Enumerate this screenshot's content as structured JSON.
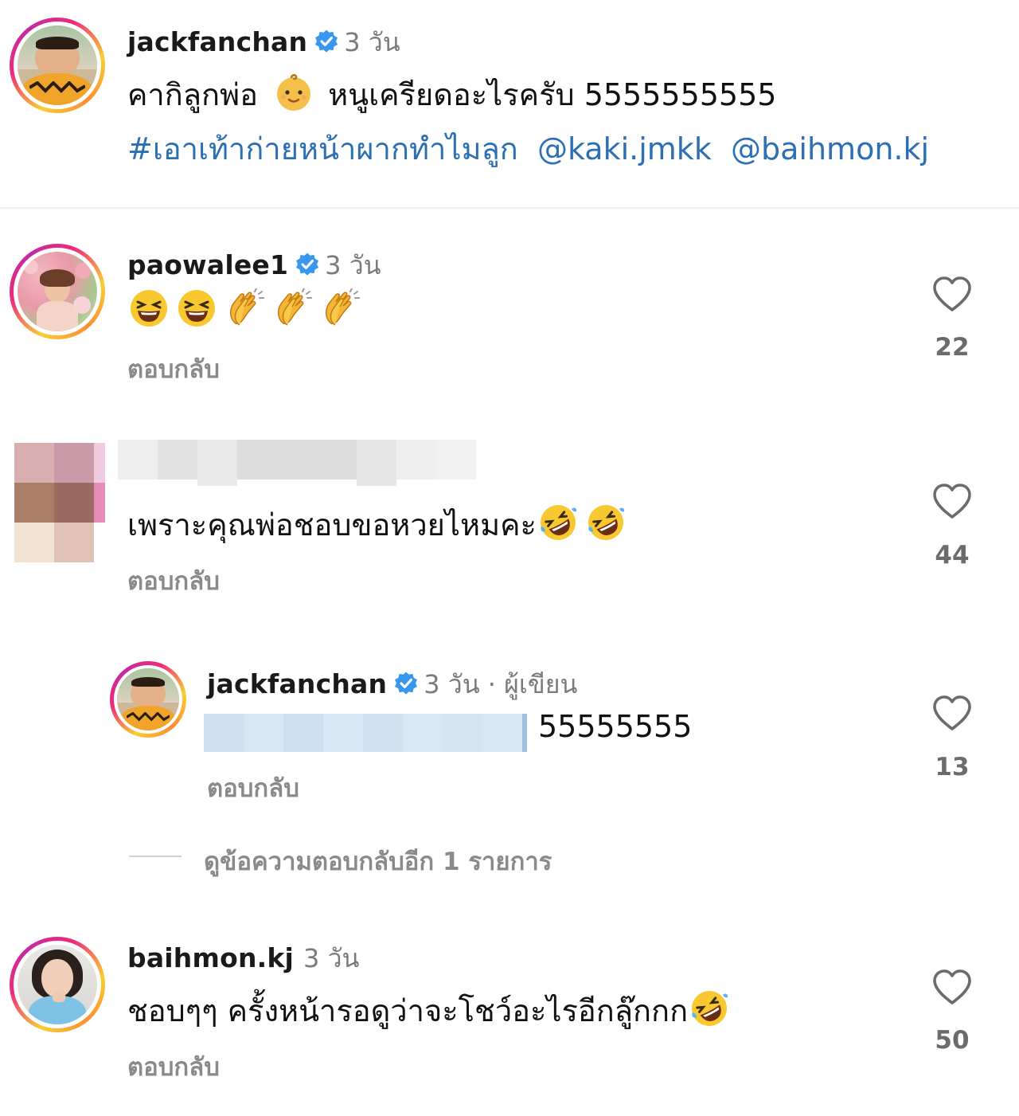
{
  "post": {
    "username": "jackfanchan",
    "time": "3 วัน",
    "caption": "คากิลูกพ่อ",
    "caption_rest": "หนูเครียดอะไรครับ 5555555555",
    "hashtag": "#เอาเท้าก่ายหน้าผากทำไมลูก",
    "mention1": "@kaki.jmkk",
    "mention2": "@baihmon.kj",
    "caption_emoji_icon": "baby-face-emoji"
  },
  "comments": [
    {
      "username": "paowalee1",
      "time": "3 วัน",
      "emojis": [
        "laughing-emoji",
        "laughing-emoji",
        "clapping-hands-emoji",
        "clapping-hands-emoji",
        "clapping-hands-emoji"
      ],
      "reply_label": "ตอบกลับ",
      "likes": "22"
    },
    {
      "username": "",
      "time": "",
      "text": "เพราะคุณพ่อชอบขอหวยไหมคะ",
      "emojis": [
        "rolling-laughing-emoji",
        "rolling-laughing-emoji"
      ],
      "reply_label": "ตอบกลับ",
      "likes": "44"
    },
    {
      "username": "jackfanchan",
      "time": "3 วัน · ผู้เขียน",
      "text": "55555555",
      "reply_label": "ตอบกลับ",
      "likes": "13"
    },
    {
      "username": "baihmon.kj",
      "time": "3 วัน",
      "text": "ชอบๆๆ ครั้งหน้ารอดูว่าจะโชว์อะไรอีกลู๊กกก",
      "emojis": [
        "rolling-laughing-emoji"
      ],
      "reply_label": "ตอบกลับ",
      "likes": "50"
    }
  ],
  "view_more_replies": "ดูข้อความตอบกลับอีก 1 รายการ",
  "colors": {
    "link": "#2c6fb3",
    "verified": "#3897f0",
    "muted": "#7a7a7a"
  }
}
